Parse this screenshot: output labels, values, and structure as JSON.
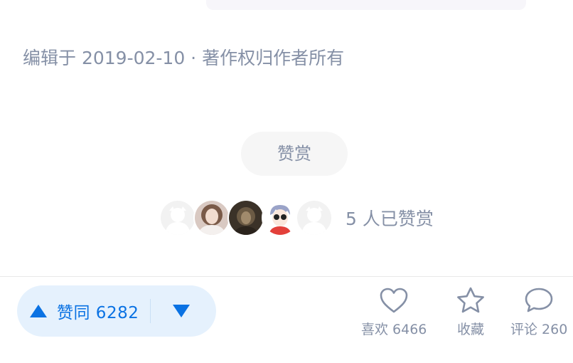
{
  "meta": {
    "edit_info": "编辑于 2019-02-10 · 著作权归作者所有"
  },
  "reward": {
    "button_label": "赞赏",
    "count_text": "5 人已赞赏",
    "avatars": [
      {
        "kind": "default-avatar"
      },
      {
        "kind": "photo-avatar"
      },
      {
        "kind": "photo-avatar"
      },
      {
        "kind": "illustrated-avatar"
      },
      {
        "kind": "default-avatar"
      }
    ]
  },
  "actions": {
    "vote_up_label": "赞同 6282",
    "like_label": "喜欢 6466",
    "collect_label": "收藏",
    "comment_label": "评论 260"
  },
  "colors": {
    "accent": "#0a72e3",
    "vote_bg": "#e5f1fd",
    "muted_text": "#8590a6",
    "pill_bg": "#f6f6f6"
  }
}
